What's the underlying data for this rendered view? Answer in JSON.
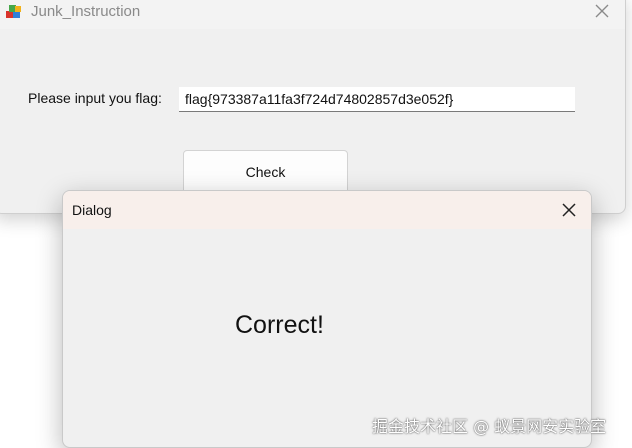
{
  "main_window": {
    "title": "Junk_Instruction",
    "app_icon": "app-cube-icon",
    "close_icon": "close-icon",
    "flag_label": "Please input you flag:",
    "flag_value": "flag{973387a11fa3f724d74802857d3e052f}",
    "check_label": "Check"
  },
  "dialog": {
    "title": "Dialog",
    "close_icon": "close-icon",
    "message": "Correct!"
  },
  "watermark": {
    "text": "掘金技术社区 @ 蚁景网安实验室"
  },
  "colors": {
    "window_bg": "#f0f0f0",
    "dialog_titlebar_bg": "#f8efeb",
    "input_bg": "#ffffff",
    "text": "#111111",
    "title_text": "#8a8a8a"
  }
}
